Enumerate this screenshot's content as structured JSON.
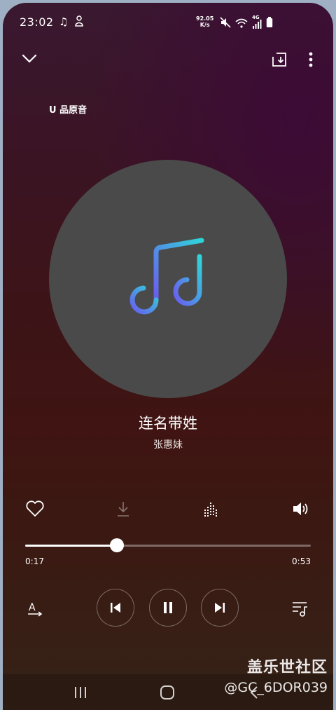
{
  "status_bar": {
    "time": "23:02",
    "net_speed_value": "92.05",
    "net_speed_unit": "K/s",
    "network_type": "4G"
  },
  "player": {
    "quality_label": "U 品原音",
    "song_title": "连名带姓",
    "artist": "张惠妹",
    "progress": {
      "elapsed": "0:17",
      "total": "0:53",
      "fraction": 0.32
    }
  },
  "watermark": {
    "brand": "盖乐世社区",
    "handle": "@GC_6DOR039"
  },
  "colors": {
    "disc": "#4a4a4a",
    "note_gradient_start": "#6a5cf0",
    "note_gradient_end": "#2fd4d8"
  },
  "icons": {
    "collapse": "chevron-down-icon",
    "share": "share-icon",
    "more": "more-vertical-icon",
    "like": "heart-icon",
    "download": "download-icon",
    "equalizer": "equalizer-icon",
    "volume": "volume-icon",
    "lyrics": "lyrics-icon",
    "previous": "previous-icon",
    "pause": "pause-icon",
    "next": "next-icon",
    "playlist": "playlist-icon"
  }
}
